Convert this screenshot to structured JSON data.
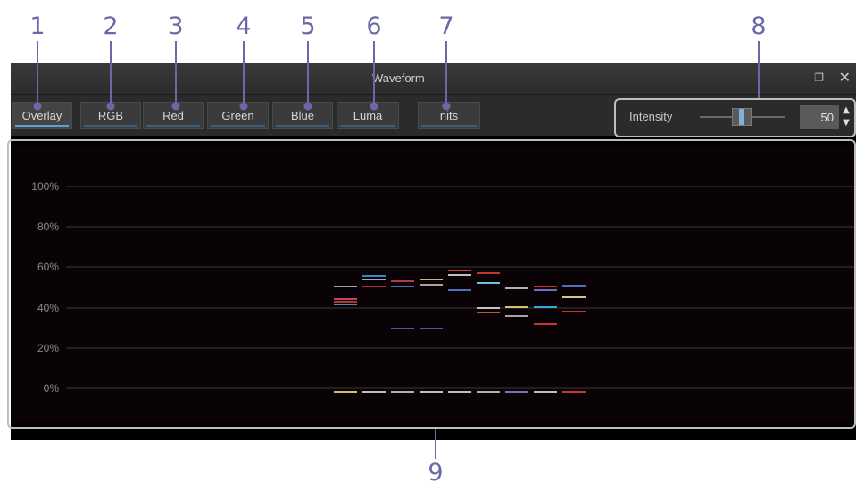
{
  "callouts": [
    "1",
    "2",
    "3",
    "4",
    "5",
    "6",
    "7",
    "8",
    "9"
  ],
  "window": {
    "title": "Waveform"
  },
  "toolbar": {
    "buttons": [
      {
        "label": "Overlay",
        "active": true
      },
      {
        "label": "RGB"
      },
      {
        "label": "Red"
      },
      {
        "label": "Green"
      },
      {
        "label": "Blue"
      },
      {
        "label": "Luma"
      },
      {
        "label": "nits"
      }
    ],
    "intensity_label": "Intensity",
    "intensity_value": "50",
    "intensity_fraction": 0.5
  },
  "scope": {
    "y_labels": [
      "100%",
      "80%",
      "60%",
      "40%",
      "20%",
      "0%"
    ]
  },
  "colors": {
    "accent": "#6a68a8",
    "active_tab": "#5aa3d8"
  }
}
